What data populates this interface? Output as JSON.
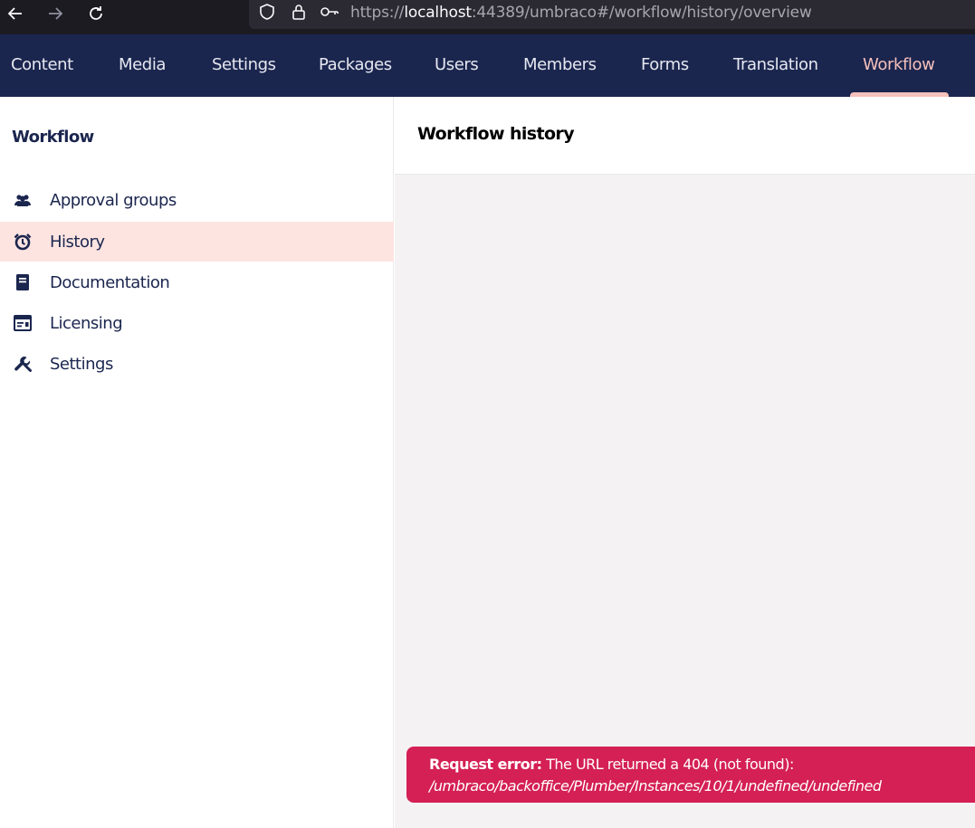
{
  "browser": {
    "url_scheme": "https://",
    "url_host": "localhost",
    "url_rest": ":44389/umbraco#/workflow/history/overview"
  },
  "header": {
    "sections": [
      "Content",
      "Media",
      "Settings",
      "Packages",
      "Users",
      "Members",
      "Forms",
      "Translation",
      "Workflow"
    ],
    "active_section": "Workflow"
  },
  "sidebar": {
    "title": "Workflow",
    "items": [
      {
        "label": "Approval groups",
        "icon": "users-icon"
      },
      {
        "label": "History",
        "icon": "alarm-clock-icon",
        "active": true
      },
      {
        "label": "Documentation",
        "icon": "book-icon"
      },
      {
        "label": "Licensing",
        "icon": "license-card-icon"
      },
      {
        "label": "Settings",
        "icon": "wrench-icon"
      }
    ]
  },
  "main": {
    "title": "Workflow history"
  },
  "notification": {
    "label": "Request error:",
    "message": " The URL returned a 404 (not found):",
    "path": "/umbraco/backoffice/Plumber/Instances/10/1/undefined/undefined"
  },
  "colors": {
    "header_bg": "#1b264f",
    "accent": "#f5c1bc",
    "active_item_bg": "#fee4e1",
    "error": "#d42054"
  }
}
